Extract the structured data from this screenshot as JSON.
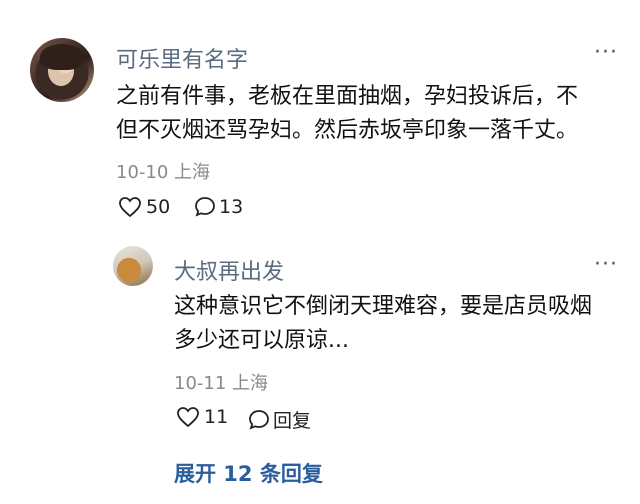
{
  "top_cut_text": "",
  "comment": {
    "username": "可乐里有名字",
    "more": "···",
    "lines": [
      "之前有件事，老板在里面抽烟，孕妇投诉后，不",
      "但不灭烟还骂孕妇。然后赤坂亭印象一落千丈。"
    ],
    "meta": "10-10 上海",
    "likes": "50",
    "replies": "13"
  },
  "reply": {
    "username": "大叔再出发",
    "more": "···",
    "lines": [
      "这种意识它不倒闭天理难容，要是店员吸烟",
      "多少还可以原谅..."
    ],
    "meta": "10-11 上海",
    "likes": "11",
    "reply_label": "回复"
  },
  "expand_label": "展开 12 条回复",
  "colors": {
    "username": "#5b6b80",
    "link": "#2b5d9c",
    "meta": "#8a8a8a"
  },
  "icons": [
    "heart-icon",
    "chat-bubble-icon"
  ]
}
